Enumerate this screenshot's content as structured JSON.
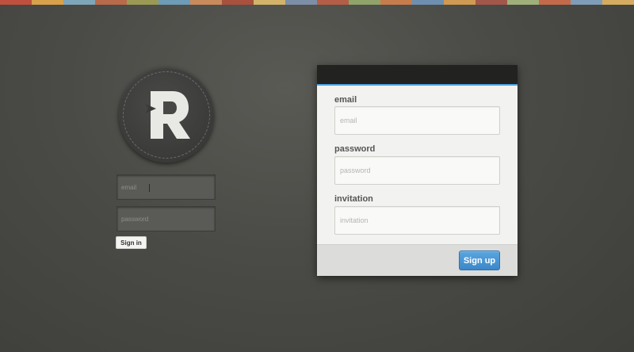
{
  "top_stripe": {
    "colors": [
      "#c0503e",
      "#d8a14a",
      "#7fa5b8",
      "#b86a4a",
      "#9b9a55",
      "#6e9bb5",
      "#c98b5b",
      "#a9503f",
      "#d3b36a",
      "#7c8fa6",
      "#b45e47",
      "#8fa36a",
      "#c77c4c",
      "#6f8fb0",
      "#d09a52",
      "#a2574a",
      "#9fb07a",
      "#c36a4a",
      "#7f9db8",
      "#d4ab60"
    ]
  },
  "logo": {
    "letter": "R",
    "icon": "r-monogram-logo"
  },
  "signin": {
    "email_placeholder": "email",
    "password_placeholder": "password",
    "button_label": "Sign in"
  },
  "signup": {
    "email_label": "email",
    "email_placeholder": "email",
    "password_label": "password",
    "password_placeholder": "password",
    "invitation_label": "invitation",
    "invitation_placeholder": "invitation",
    "button_label": "Sign up"
  },
  "colors": {
    "accent": "#4aa3df",
    "button_blue": "#3b87c9",
    "background": "#4a4a46"
  }
}
